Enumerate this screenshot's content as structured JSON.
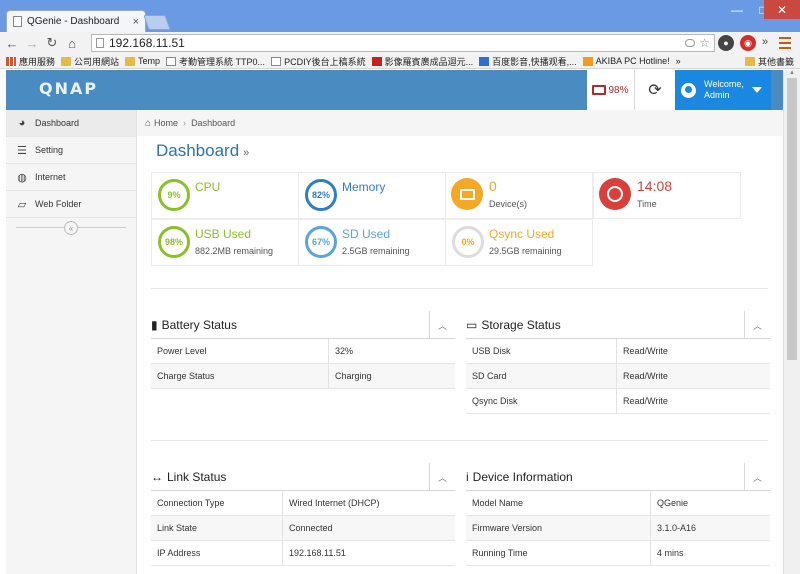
{
  "browser": {
    "tab_title": "QGenie - Dashboard",
    "tab_close": "×",
    "url": "192.168.11.51",
    "win_min": "—",
    "win_max": "□",
    "win_close": "✕",
    "bookmarks": [
      {
        "label": "應用服務",
        "icon": "apps"
      },
      {
        "label": "公司用網站",
        "icon": "folder"
      },
      {
        "label": "Temp",
        "icon": "folder"
      },
      {
        "label": "考勤管理系統 TTP0...",
        "icon": "page"
      },
      {
        "label": "PCDIY後台上稿系統",
        "icon": "page"
      },
      {
        "label": "影像羅賓廣成品迴元...",
        "icon": "red"
      },
      {
        "label": "百度影音,快播观看,...",
        "icon": "blue"
      },
      {
        "label": "AKIBA PC Hotline!",
        "icon": "orange"
      }
    ],
    "bookmarks_more": "»",
    "bookmarks_other": "其他書籤"
  },
  "header": {
    "logo": "QNAP",
    "battery_level": "98%",
    "welcome": "Welcome,",
    "user": "Admin"
  },
  "sidebar": {
    "items": [
      {
        "label": "Dashboard",
        "icon": "dashboard-icon"
      },
      {
        "label": "Setting",
        "icon": "list-icon"
      },
      {
        "label": "Internet",
        "icon": "globe-icon"
      },
      {
        "label": "Web Folder",
        "icon": "folder-open-icon"
      }
    ],
    "collapse": "«"
  },
  "breadcrumb": {
    "home": "Home",
    "current": "Dashboard"
  },
  "page_title": "Dashboard",
  "page_title_suffix": "»",
  "tiles": {
    "cpu": {
      "label": "CPU",
      "percent": "9%",
      "color": "#8bbf2b"
    },
    "memory": {
      "label": "Memory",
      "percent": "82%",
      "color": "#2f7ec1"
    },
    "devices": {
      "label": "0",
      "sub": "Device(s)",
      "color": "#f4a825"
    },
    "time": {
      "label": "14:08",
      "sub": "Time",
      "color": "#d9403c"
    },
    "usb": {
      "label": "USB Used",
      "percent": "98%",
      "sub": "882.2MB remaining",
      "color": "#8bbf2b"
    },
    "sd": {
      "label": "SD Used",
      "percent": "67%",
      "sub": "2.5GB remaining",
      "color": "#5ba4d8"
    },
    "qsync": {
      "label": "Qsync Used",
      "percent": "0%",
      "sub": "29.5GB remaining",
      "color": "#f4a825"
    }
  },
  "battery_status": {
    "title": "Battery Status",
    "rows": [
      {
        "key": "Power Level",
        "value": "32%"
      },
      {
        "key": "Charge Status",
        "value": "Charging"
      }
    ]
  },
  "storage_status": {
    "title": "Storage Status",
    "rows": [
      {
        "key": "USB Disk",
        "value": "Read/Write"
      },
      {
        "key": "SD Card",
        "value": "Read/Write"
      },
      {
        "key": "Qsync Disk",
        "value": "Read/Write"
      }
    ]
  },
  "link_status": {
    "title": "Link Status",
    "rows": [
      {
        "key": "Connection Type",
        "value": "Wired Internet (DHCP)"
      },
      {
        "key": "Link State",
        "value": "Connected"
      },
      {
        "key": "IP Address",
        "value": "192.168.11.51"
      }
    ]
  },
  "device_information": {
    "title": "Device Information",
    "rows": [
      {
        "key": "Model Name",
        "value": "QGenie"
      },
      {
        "key": "Firmware Version",
        "value": "3.1.0-A16"
      },
      {
        "key": "Running Time",
        "value": "4 mins"
      }
    ]
  },
  "panel_toggle": "︿"
}
